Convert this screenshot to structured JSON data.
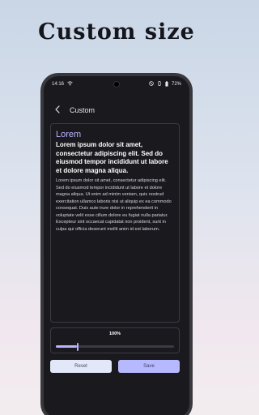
{
  "banner": {
    "title": "Custom size"
  },
  "status_bar": {
    "time": "14:16",
    "battery": "72%",
    "icons": [
      "wifi-icon",
      "do-not-disturb-icon",
      "battery-icon"
    ]
  },
  "app_bar": {
    "title": "Custom",
    "back_icon": "back-arrow-icon"
  },
  "preview": {
    "heading": "Lorem",
    "subheading": "Lorem ipsum dolor sit amet, consectetur adipiscing elit. Sed do eiusmod tempor incididunt ut labore et dolore magna aliqua.",
    "body": "Lorem ipsum dolor sit amet, consectetur adipiscing elit. Sed do eiusmod tempor incididunt ut labore et dolore magna aliqua. Ut enim ad minim veniam, quis nostrud exercitation ullamco laboris nisi ut aliquip ex ea commodo consequat. Duis aute irure dolor in reprehenderit in voluptate velit esse cillum dolore eu fugiat nulla pariatur. Excepteur sint occaecat cupidatat non proident, sunt in culpa qui officia deserunt mollit anim id est laborum."
  },
  "size_control": {
    "percent_label": "100%",
    "slider_fraction": 0.18
  },
  "actions": {
    "reset_label": "Reset",
    "save_label": "Save"
  },
  "colors": {
    "accent": "#b7b3ff",
    "background": "#1a191e",
    "reset_button": "#e2e8f8",
    "save_button": "#b7b9ff"
  }
}
